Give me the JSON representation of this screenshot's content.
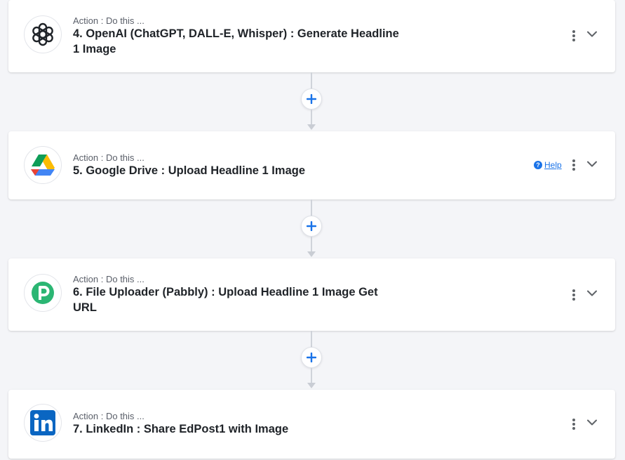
{
  "steps": [
    {
      "subtitle": "Action : Do this ...",
      "title": "4. OpenAI (ChatGPT, DALL-E, Whisper) : Generate Headline 1 Image",
      "icon": "openai-icon"
    },
    {
      "subtitle": "Action : Do this ...",
      "title": "5. Google Drive : Upload Headline 1 Image",
      "icon": "google-drive-icon",
      "help_label": "Help"
    },
    {
      "subtitle": "Action : Do this ...",
      "title": "6. File Uploader (Pabbly) : Upload Headline 1 Image Get URL",
      "icon": "pabbly-icon"
    },
    {
      "subtitle": "Action : Do this ...",
      "title": "7. LinkedIn : Share EdPost1 with Image",
      "icon": "linkedin-icon"
    }
  ],
  "colors": {
    "accent": "#1a73e8",
    "pabbly": "#2bb673",
    "linkedin": "#0a66c2"
  }
}
